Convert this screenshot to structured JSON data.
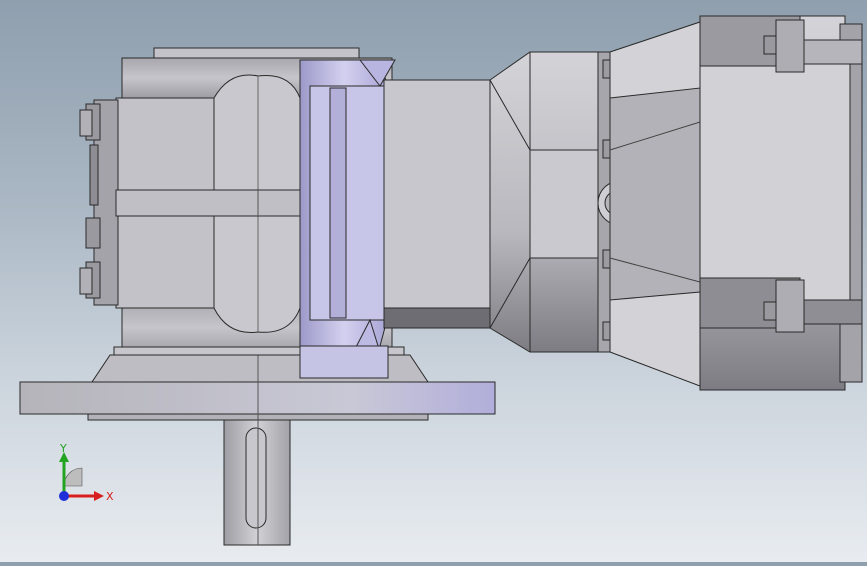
{
  "viewport": {
    "background_top": "#8f9fae",
    "background_bottom": "#e8ecf0",
    "model_description_hidden": false
  },
  "triad": {
    "x_label": "X",
    "y_label": "Y",
    "x_color": "#d81e1e",
    "y_color": "#22a322",
    "z_color": "#1e2ed8"
  },
  "colors": {
    "body_main": "#c3c2c8",
    "body_dark": "#8c8b92",
    "body_light": "#d8d7dd",
    "accent_blue": "#b9b6e0",
    "outline": "#2a2a2a"
  }
}
